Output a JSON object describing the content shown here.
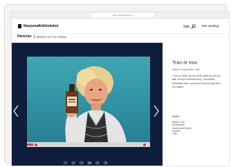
{
  "browser": {
    "url": "nasjonalbiblioteket.no"
  },
  "header": {
    "logo": "Nasjonalbiblioteket",
    "search_label": "Søk",
    "collection_label": "Min samling"
  },
  "breadcrumb": {
    "main": "Historier",
    "sub": "Mellom Ad Fra reklam"
  },
  "viewer": {
    "progress": 0.05,
    "pages": [
      "01",
      "02",
      "03",
      "04",
      "05",
      "06"
    ],
    "active_page": "04"
  },
  "info": {
    "title": "Tran er tron",
    "subtitle": "Møllers reklamefilm 1960",
    "body": "«Tran er tron» av de på 60-tallet og der hvr åtte nå mye forandret seg. Framdeles anbefales barn og voksne å ta en skje tran om dagen.",
    "meta": [
      "Møllers Tran",
      "Reklamefilm",
      "Nasjonalbiblioteket",
      "Historier",
      "1960"
    ]
  },
  "colors": {
    "viewer_bg": "#0f1e3c",
    "accent": "#d9365b"
  }
}
